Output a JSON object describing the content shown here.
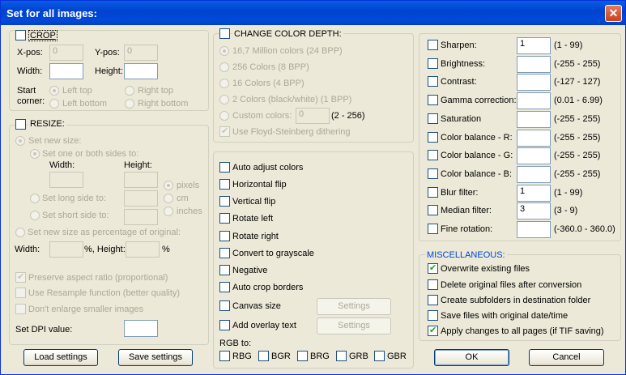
{
  "window": {
    "title": "Set for all images:",
    "close_glyph": "✕"
  },
  "crop": {
    "label": "CROP",
    "xpos_label": "X-pos:",
    "xpos_value": "0",
    "ypos_label": "Y-pos:",
    "ypos_value": "0",
    "width_label": "Width:",
    "height_label": "Height:",
    "start_corner_label_1": "Start",
    "start_corner_label_2": "corner:",
    "left_top": "Left top",
    "right_top": "Right top",
    "left_bottom": "Left bottom",
    "right_bottom": "Right bottom"
  },
  "resize": {
    "label": "RESIZE:",
    "set_new_size": "Set new size:",
    "set_one_or_both": "Set one or both sides to:",
    "width_label": "Width:",
    "height_label": "Height:",
    "pixels": "pixels",
    "cm": "cm",
    "inches": "inches",
    "long_side": "Set long side to:",
    "short_side": "Set short side to:",
    "percentage": "Set new size as percentage of original:",
    "pct_width_label": "Width:",
    "pct_sep": "%, Height:",
    "pct_suffix": "%",
    "preserve_aspect": "Preserve aspect ratio (proportional)",
    "use_resample": "Use Resample function (better quality)",
    "dont_enlarge": "Don't enlarge smaller images",
    "dpi_label": "Set DPI value:"
  },
  "color_depth": {
    "label": "CHANGE COLOR DEPTH:",
    "opt_24": "16,7 Million colors (24 BPP)",
    "opt_8": "256 Colors (8 BPP)",
    "opt_4": "16 Colors (4 BPP)",
    "opt_1": "2 Colors (black/white) (1 BPP)",
    "custom": "Custom colors:",
    "custom_value": "0",
    "custom_range": "(2 - 256)",
    "dithering": "Use Floyd-Steinberg dithering"
  },
  "transforms": {
    "auto_adjust": "Auto adjust colors",
    "hflip": "Horizontal flip",
    "vflip": "Vertical flip",
    "rotate_left": "Rotate left",
    "rotate_right": "Rotate right",
    "grayscale": "Convert to grayscale",
    "negative": "Negative",
    "autocrop": "Auto crop borders",
    "canvas": "Canvas size",
    "overlay": "Add overlay text",
    "settings": "Settings",
    "rgb_to": "RGB to:",
    "rgb_opts": [
      "RBG",
      "BGR",
      "BRG",
      "GRB",
      "GBR"
    ]
  },
  "adjust": [
    {
      "label": "Sharpen:",
      "value": "1",
      "range": "(1  -  99)"
    },
    {
      "label": "Brightness:",
      "value": "",
      "range": "(-255  -  255)"
    },
    {
      "label": "Contrast:",
      "value": "",
      "range": "(-127  -  127)"
    },
    {
      "label": "Gamma correction:",
      "value": "",
      "range": "(0.01  -  6.99)"
    },
    {
      "label": "Saturation",
      "value": "",
      "range": "(-255  -  255)"
    },
    {
      "label": "Color balance - R:",
      "value": "",
      "range": "(-255  -  255)"
    },
    {
      "label": "Color balance - G:",
      "value": "",
      "range": "(-255  -  255)"
    },
    {
      "label": "Color balance - B:",
      "value": "",
      "range": "(-255  -  255)"
    },
    {
      "label": "Blur filter:",
      "value": "1",
      "range": "(1  -  99)"
    },
    {
      "label": "Median filter:",
      "value": "3",
      "range": "(3  -  9)"
    },
    {
      "label": "Fine rotation:",
      "value": "",
      "range": "(-360.0  -  360.0)"
    }
  ],
  "misc": {
    "label": "MISCELLANEOUS:",
    "overwrite": "Overwrite existing files",
    "delete_original": "Delete original files after conversion",
    "create_subfolders": "Create subfolders in destination folder",
    "save_date": "Save files with original date/time",
    "apply_all_pages": "Apply changes to all pages (if TIF saving)"
  },
  "buttons": {
    "load": "Load settings",
    "save": "Save settings",
    "ok": "OK",
    "cancel": "Cancel"
  },
  "colors": {
    "title_bar": "#0049d8",
    "misc_label": "#0046d5",
    "check": "#21a121"
  }
}
